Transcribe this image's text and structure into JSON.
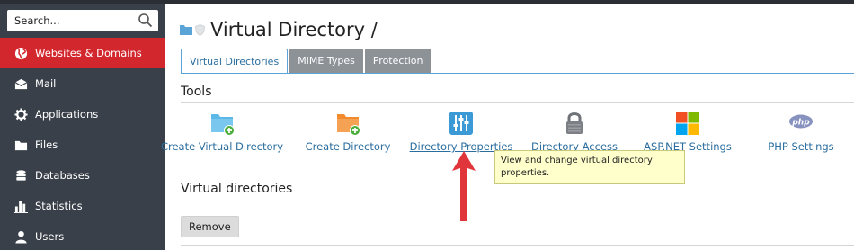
{
  "search": {
    "placeholder": "Search..."
  },
  "sidebar": {
    "items": [
      {
        "label": "Websites & Domains",
        "icon": "globe-icon",
        "active": true
      },
      {
        "label": "Mail",
        "icon": "mail-icon"
      },
      {
        "label": "Applications",
        "icon": "gear-icon"
      },
      {
        "label": "Files",
        "icon": "folder-icon"
      },
      {
        "label": "Databases",
        "icon": "database-icon"
      },
      {
        "label": "Statistics",
        "icon": "bar-chart-icon"
      },
      {
        "label": "Users",
        "icon": "user-icon"
      }
    ]
  },
  "page": {
    "title": "Virtual Directory /"
  },
  "tabs": [
    {
      "label": "Virtual Directories",
      "active": true
    },
    {
      "label": "MIME Types"
    },
    {
      "label": "Protection"
    }
  ],
  "tools": {
    "heading": "Tools",
    "items": [
      {
        "label": "Create Virtual Directory",
        "icon": "folder-add-blue-icon"
      },
      {
        "label": "Create Directory",
        "icon": "folder-add-orange-icon"
      },
      {
        "label": "Directory Properties",
        "icon": "sliders-icon",
        "hovered": true
      },
      {
        "label": "Directory Access",
        "icon": "lock-icon"
      },
      {
        "label": "ASP.NET Settings",
        "icon": "windows-logo-icon"
      },
      {
        "label": "PHP Settings",
        "icon": "php-icon"
      }
    ],
    "tooltip": "View and change virtual directory properties."
  },
  "virtual_directories": {
    "heading": "Virtual directories",
    "remove_label": "Remove"
  },
  "colors": {
    "sidebar_bg": "#3a4049",
    "active_red": "#d3272e",
    "link_blue": "#2a6d9e",
    "tab_border": "#5aa4d8",
    "arrow_red": "#e0353b",
    "tooltip_bg": "#ffffcc"
  }
}
